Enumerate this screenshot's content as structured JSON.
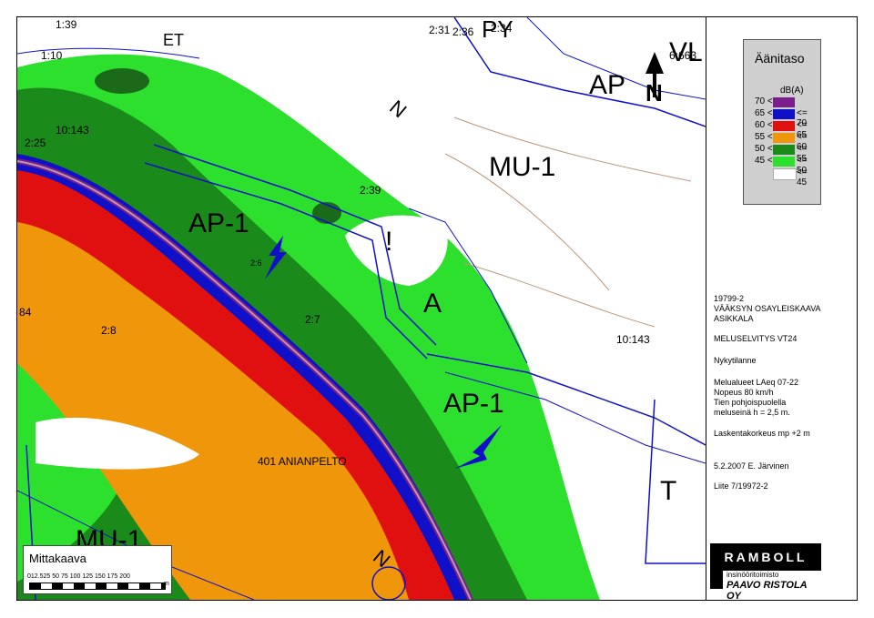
{
  "map_labels": {
    "top_left_1": "1:39",
    "top_left_2": "1:10",
    "et": "ET",
    "py": "PY",
    "num_231": "2:31",
    "num_236": "2:36",
    "num_234": "2:34",
    "ap": "AP",
    "vl": "VL",
    "num_6663": "6:663",
    "n_diag": "N",
    "num_10143_a": "10:143",
    "num_225": "2:25",
    "mu1_top": "MU-1",
    "num_239": "2:39",
    "ap1_left": "AP-1",
    "num_26": "2:6",
    "num_84": "84",
    "num_28": "2:8",
    "num_27": "2:7",
    "a": "A",
    "exclaim": "!",
    "num_10143_b": "10:143",
    "ap1_right": "AP-1",
    "road_name": "401 ANIANPELTO",
    "t": "T",
    "mu1_bottom": "MU-1",
    "n_bottom": "N"
  },
  "north_arrow": {
    "letter": "N"
  },
  "legend": {
    "title": "Äänitaso",
    "unit": "dB(A)",
    "rows": [
      {
        "lo": "70 <",
        "hi": "",
        "color": "#7a1e8c"
      },
      {
        "lo": "65 <",
        "hi": "<= 70",
        "color": "#1010c8"
      },
      {
        "lo": "60 <",
        "hi": "<= 65",
        "color": "#e01010"
      },
      {
        "lo": "55 <",
        "hi": "<= 60",
        "color": "#f0960a"
      },
      {
        "lo": "50 <",
        "hi": "<= 55",
        "color": "#1a8a1a"
      },
      {
        "lo": "45 <",
        "hi": "<= 50",
        "color": "#2ee02e"
      },
      {
        "lo": "",
        "hi": "<= 45",
        "color": "#ffffff"
      }
    ]
  },
  "info": {
    "project_no": "19799-2",
    "project_name": "VÄÄKSYN OSAYLEISKAAVA",
    "project_sub": "ASIKKALA",
    "study": "MELUSELVITYS VT24",
    "state": "Nykytilanne",
    "zones": "Melualueet LAeq 07-22",
    "speed": "Nopeus 80 km/h",
    "barrier_1": "Tien pohjoispuolella",
    "barrier_2": "meluseinä h = 2,5 m.",
    "calc_height": "Laskentakorkeus mp +2 m",
    "date_author": "5.2.2007 E. Järvinen",
    "appendix": "Liite 7/19972-2"
  },
  "scale": {
    "title": "Mittakaava",
    "ticks": "012.525   50   75   100  125  150  175  200",
    "unit": "m"
  },
  "logo": {
    "company": "RAMBOLL",
    "line1": "insinööritoimisto",
    "line2": "PAAVO RISTOLA OY"
  }
}
